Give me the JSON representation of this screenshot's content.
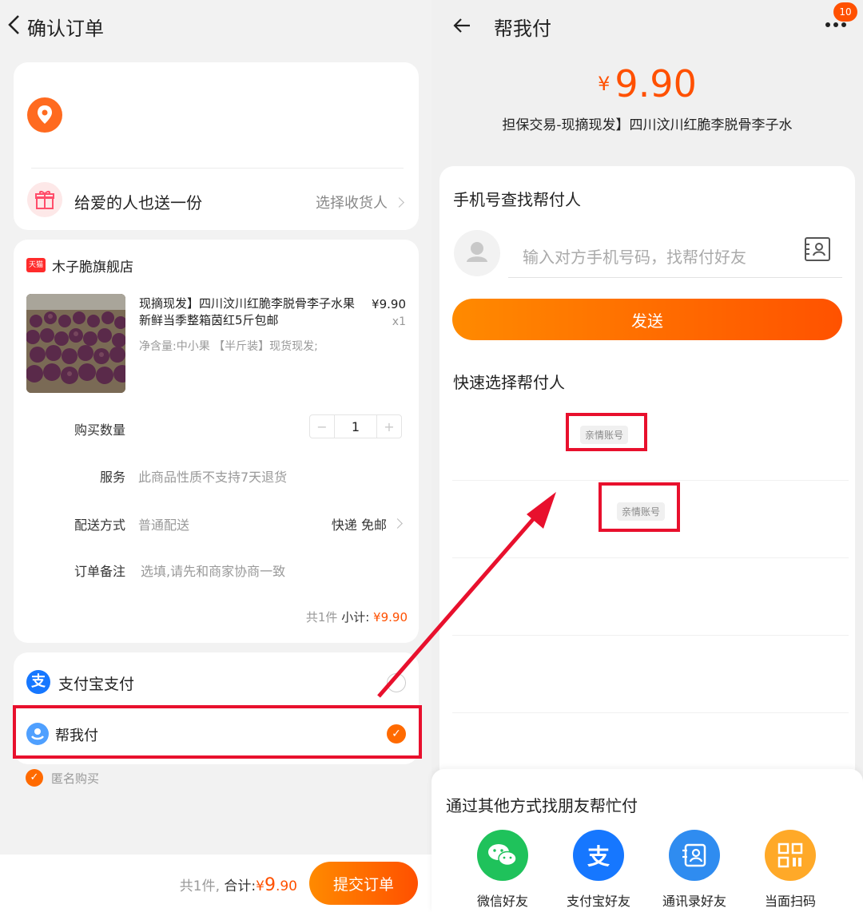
{
  "left": {
    "header": {
      "title": "确认订单"
    },
    "address_card": {
      "gift_text": "给爱的人也送一份",
      "gift_link": "选择收货人"
    },
    "order": {
      "shop_badge": "天猫",
      "shop_name": "木子脆旗舰店",
      "product_title": "现摘现发】四川汶川红脆李脱骨李子水果新鲜当季整箱茵红5斤包邮",
      "product_spec": "净含量:中小果 【半斤装】现货现发;",
      "price": "¥9.90",
      "qty": "x1",
      "quantity_label": "购买数量",
      "stepper": {
        "minus": "−",
        "value": "1",
        "plus": "+"
      },
      "service_label": "服务",
      "service_value": "此商品性质不支持7天退货",
      "delivery_label": "配送方式",
      "delivery_value": "普通配送",
      "delivery_right": "快递 免邮",
      "remark_label": "订单备注",
      "remark_placeholder": "选填,请先和商家协商一致",
      "subtotal_count": "共1件",
      "subtotal_label": "小计:",
      "subtotal_value": "¥9.90"
    },
    "payment": {
      "alipay_logo": "支",
      "alipay_label": "支付宝支付",
      "helppay_label": "帮我付",
      "check": "✓"
    },
    "anonymous": {
      "label": "匿名购买"
    },
    "bottom_bar": {
      "count": "共1件,",
      "total_label": "合计:",
      "currency": "¥",
      "amount_int": "9",
      "amount_dec": ".90",
      "submit": "提交订单"
    }
  },
  "right": {
    "header": {
      "title": "帮我付",
      "badge": "10"
    },
    "amount": {
      "currency": "¥",
      "value": "9.90"
    },
    "description": "担保交易-现摘现发】四川汶川红脆李脱骨李子水",
    "phone_section": {
      "title": "手机号查找帮付人",
      "placeholder": "输入对方手机号码，找帮付好友",
      "send": "发送"
    },
    "quick_section": {
      "title": "快速选择帮付人",
      "tags": [
        "亲情账号",
        "亲情账号"
      ]
    },
    "sheet": {
      "title": "通过其他方式找朋友帮忙付",
      "items": [
        {
          "label": "微信好友",
          "icon": "wechat-icon",
          "color": "#1fc25b"
        },
        {
          "label": "支付宝好友",
          "icon": "alipay-icon",
          "color": "#1677ff"
        },
        {
          "label": "通讯录好友",
          "icon": "contacts-icon",
          "color": "#2f8cf0"
        },
        {
          "label": "当面扫码",
          "icon": "qrcode-icon",
          "color": "#ffa928"
        }
      ]
    }
  },
  "colors": {
    "accent": "#ff5000",
    "highlight_box": "#e8102d",
    "alipay_blue": "#1677ff"
  }
}
